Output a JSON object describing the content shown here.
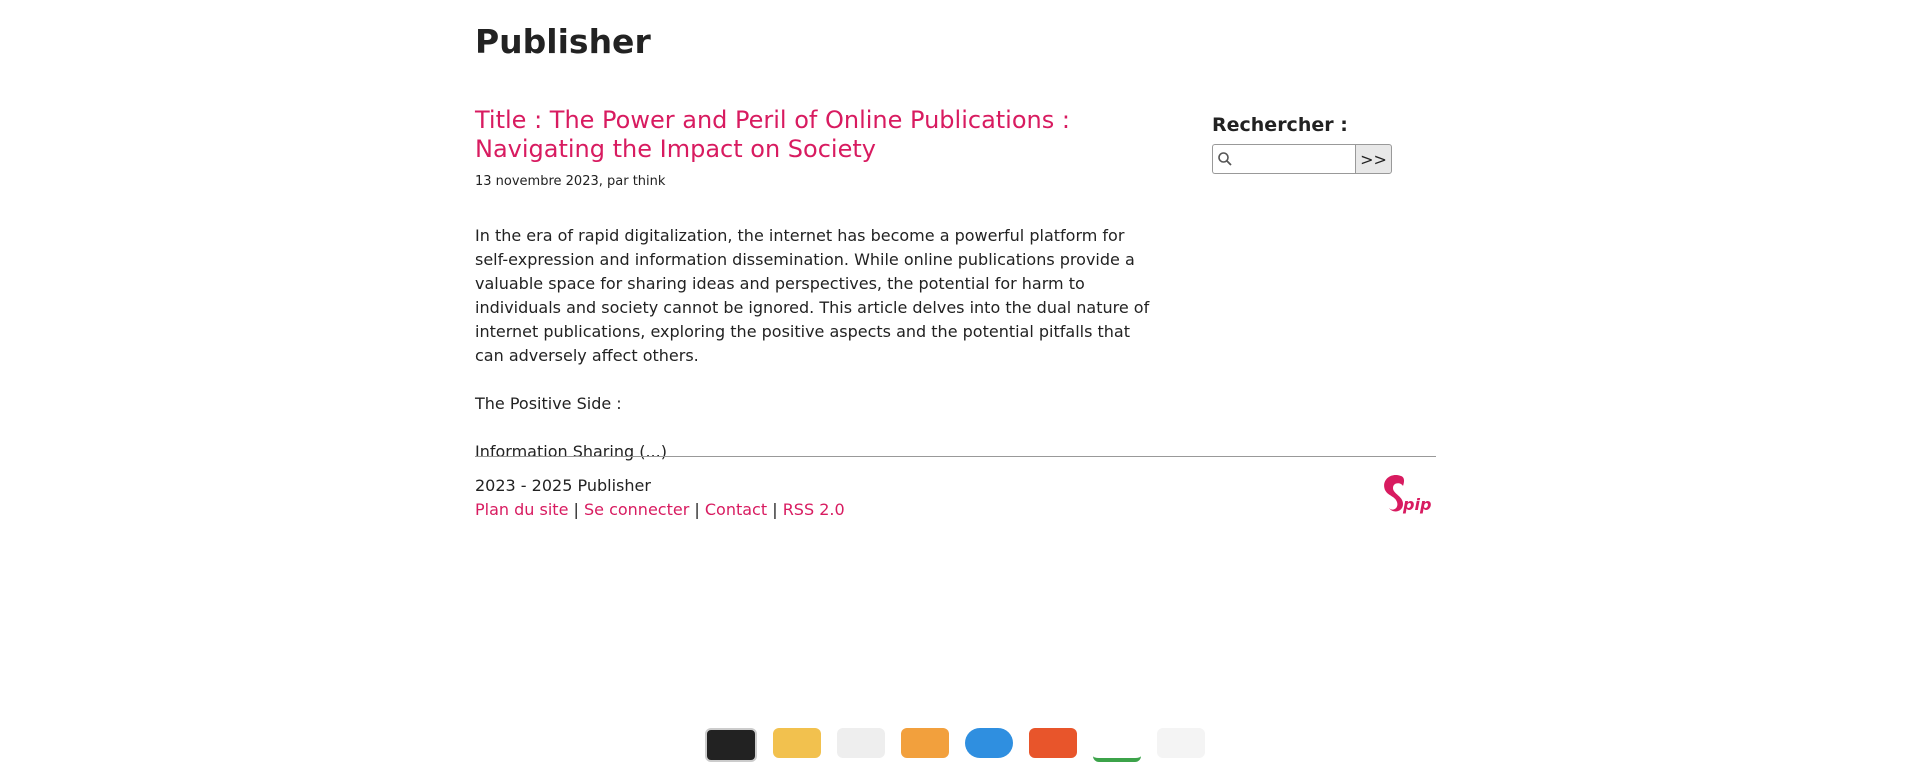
{
  "site": {
    "title": "Publisher"
  },
  "article": {
    "title": "Title : The Power and Peril of Online Publications : Navigating the Impact on Society",
    "info": "13 novembre 2023, par think",
    "body": "In the era of rapid digitalization, the internet has become a powerful platform for self-expression and information dissemination. While online publications provide a valuable space for sharing ideas and perspectives, the potential for harm to individuals and society cannot be ignored. This article delves into the dual nature of internet publications, exploring the positive aspects and the potential pitfalls that can adversely affect others.",
    "body2": "The Positive Side :",
    "body3": "Information Sharing (...)"
  },
  "search": {
    "label": "Rechercher :",
    "value": "",
    "button": ">>"
  },
  "footer": {
    "copyright": "2023 - 2025 Publisher",
    "links": [
      "Plan du site",
      "Se connecter",
      "Contact",
      "RSS 2.0"
    ],
    "separator": "|",
    "logo_text": "Spip"
  },
  "colors": {
    "accent": "#d81b60",
    "text": "#222222",
    "rule": "#999999"
  },
  "dock": {
    "icons": [
      "terminal-icon",
      "folder-icon",
      "text-editor-icon",
      "files-icon",
      "browser-icon",
      "package-icon",
      "feather-icon",
      "apps-icon"
    ]
  }
}
